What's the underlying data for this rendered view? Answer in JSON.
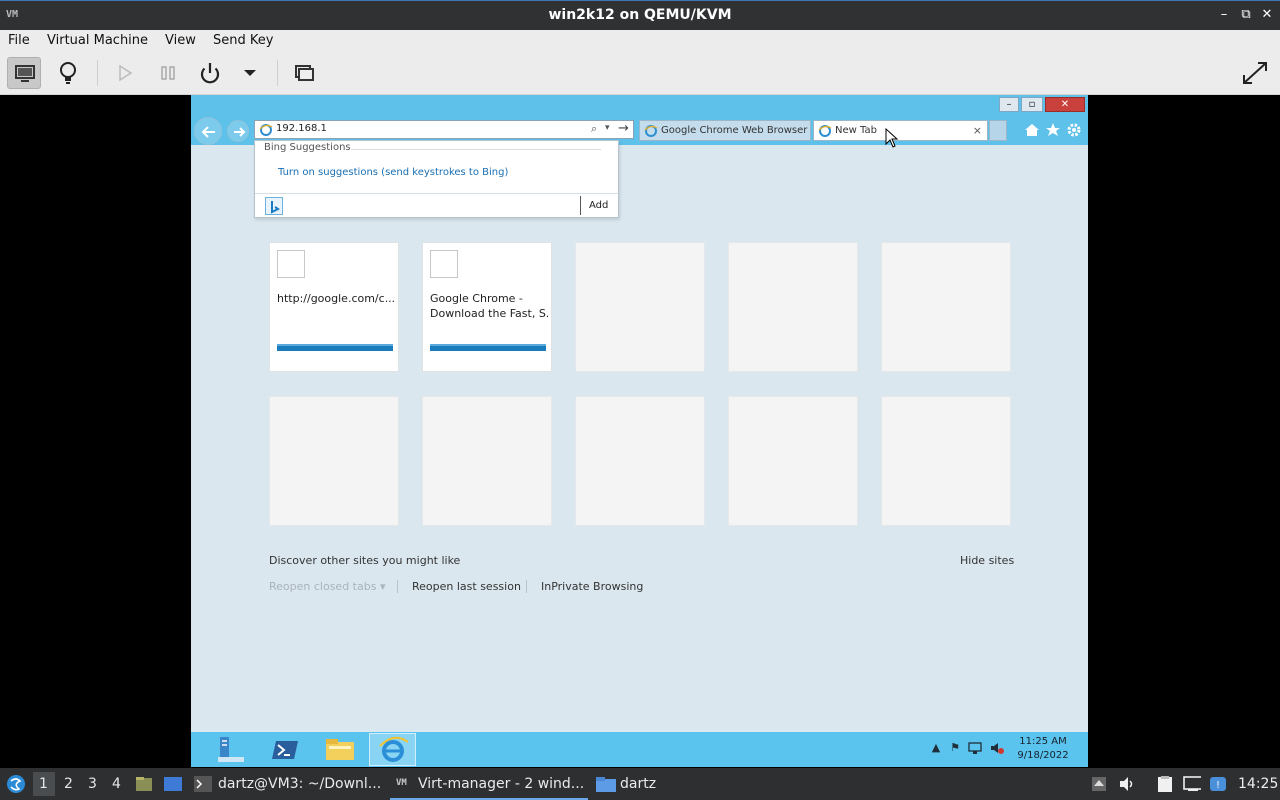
{
  "host_window": {
    "title": "win2k12 on QEMU/KVM",
    "app_logo": "VM",
    "controls": {
      "minimize": "–",
      "restore": "⧉",
      "close": "✕"
    }
  },
  "menubar": {
    "items": [
      "File",
      "Virtual Machine",
      "View",
      "Send Key"
    ]
  },
  "toolbar": {
    "icons": [
      "monitor-icon",
      "lightbulb-icon",
      "play-icon",
      "pause-icon",
      "power-icon",
      "dropdown-arrow-icon",
      "snapshot-icon",
      "fullscreen-icon"
    ]
  },
  "ie": {
    "address": "192.168.1",
    "tabs": [
      {
        "label": "Google Chrome Web Browser",
        "active": false
      },
      {
        "label": "New Tab",
        "active": true,
        "close": "×"
      }
    ],
    "window_controls": {
      "minimize": "–",
      "restore": "▫",
      "close": "✕"
    },
    "dropdown": {
      "header": "Bing Suggestions",
      "suggestion_link": "Turn on suggestions (send keystrokes to Bing)",
      "add_label": "Add"
    },
    "tiles": [
      {
        "title": "http://google.com/c...",
        "line2": "",
        "filled": true
      },
      {
        "title": "Google Chrome -",
        "line2": "Download the Fast, S...",
        "filled": true
      },
      {
        "filled": false
      },
      {
        "filled": false
      },
      {
        "filled": false
      },
      {
        "filled": false
      },
      {
        "filled": false
      },
      {
        "filled": false
      },
      {
        "filled": false
      },
      {
        "filled": false
      }
    ],
    "discover_text": "Discover other sites you might like",
    "hide_sites": "Hide sites",
    "reopen_closed": "Reopen closed tabs",
    "reopen_closed_caret": "▾",
    "reopen_last": "Reopen last session",
    "inprivate": "InPrivate Browsing"
  },
  "guest_taskbar": {
    "clock_time": "11:25 AM",
    "clock_date": "9/18/2022",
    "tray_expand": "▲"
  },
  "host_panel": {
    "workspaces": [
      "1",
      "2",
      "3",
      "4"
    ],
    "tasks": [
      {
        "label": "dartz@VM3: ~/Downl...",
        "active": false
      },
      {
        "label": "Virt-manager - 2 wind...",
        "active": true
      },
      {
        "label": "dartz",
        "active": false
      }
    ],
    "clock": "14:25"
  },
  "colors": {
    "ie_frame": "#5ec1ea",
    "page_bg": "#dbe7ef",
    "link_blue": "#1a6fb3",
    "tile_bar": "#1b7cbb"
  }
}
